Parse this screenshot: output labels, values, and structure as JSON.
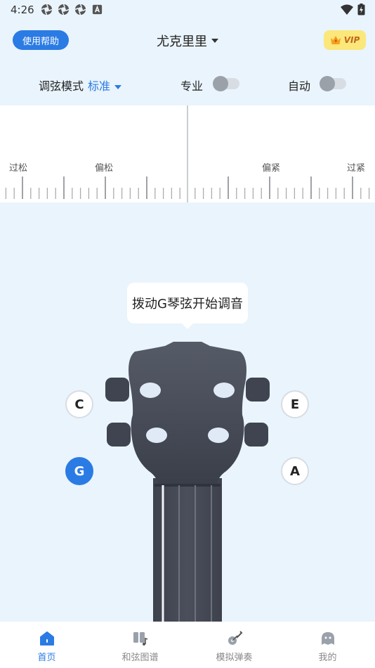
{
  "status": {
    "time": "4:26"
  },
  "header": {
    "help_label": "使用帮助",
    "instrument": "尤克里里",
    "vip_label": "VIP"
  },
  "modes": {
    "tuning_mode_label": "调弦模式",
    "tuning_mode_value": "标准",
    "pro_label": "专业",
    "pro_on": false,
    "auto_label": "自动",
    "auto_on": false
  },
  "meter": {
    "labels": [
      "过松",
      "偏松",
      "偏紧",
      "过紧"
    ]
  },
  "prompt": "拨动G琴弦开始调音",
  "pegs": {
    "c": "C",
    "e": "E",
    "g": "G",
    "a": "A",
    "active": "G"
  },
  "colors": {
    "accent": "#2b7be4",
    "headstock": "#464b57",
    "background": "#eaf4fc"
  },
  "tabs": [
    {
      "label": "首页",
      "icon": "home-icon",
      "active": true
    },
    {
      "label": "和弦图谱",
      "icon": "chord-book-icon",
      "active": false
    },
    {
      "label": "模拟弹奏",
      "icon": "guitar-icon",
      "active": false
    },
    {
      "label": "我的",
      "icon": "profile-icon",
      "active": false
    }
  ]
}
